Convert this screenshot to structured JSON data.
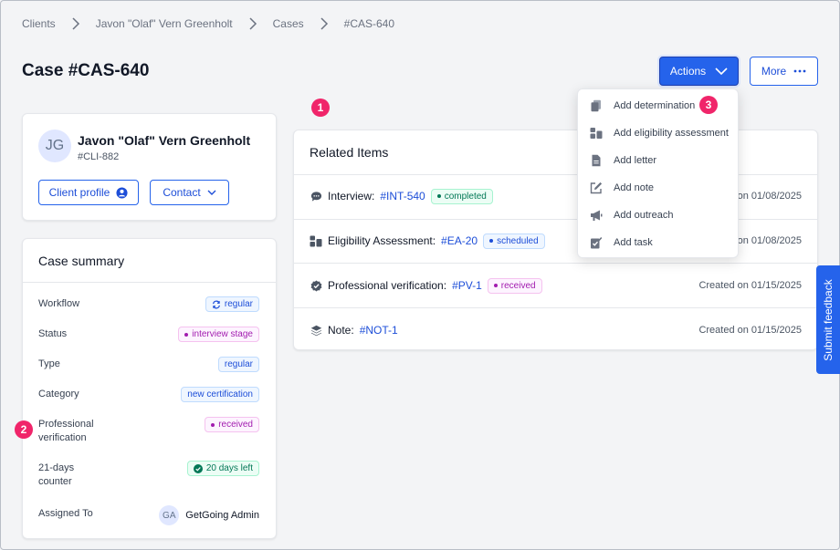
{
  "breadcrumb": {
    "items": [
      "Clients",
      "Javon \"Olaf\" Vern Greenholt",
      "Cases",
      "#CAS-640"
    ]
  },
  "page": {
    "title": "Case #CAS-640"
  },
  "header_actions": {
    "actions_label": "Actions",
    "more_label": "More"
  },
  "client": {
    "initials": "JG",
    "name": "Javon \"Olaf\" Vern Greenholt",
    "id": "#CLI-882",
    "profile_button": "Client profile",
    "contact_button": "Contact"
  },
  "summary": {
    "title": "Case summary",
    "rows": [
      {
        "label": "Workflow",
        "value": "regular"
      },
      {
        "label": "Status",
        "value": "interview stage"
      },
      {
        "label": "Type",
        "value": "regular"
      },
      {
        "label": "Category",
        "value": "new certification"
      },
      {
        "label": "Professional verification",
        "value": "received"
      },
      {
        "label": "21-days counter",
        "value": "20 days left"
      },
      {
        "label": "Assigned To",
        "value": "GetGoing Admin",
        "initials": "GA"
      }
    ]
  },
  "related": {
    "title": "Related Items",
    "items": [
      {
        "type": "Interview:",
        "link": "#INT-540",
        "badge": "completed",
        "date": "on 01/08/2025"
      },
      {
        "type": "Eligibility Assessment:",
        "link": "#EA-20",
        "badge": "scheduled",
        "date": "on 01/08/2025"
      },
      {
        "type": "Professional verification:",
        "link": "#PV-1",
        "badge": "received",
        "date": "Created on 01/15/2025"
      },
      {
        "type": "Note:",
        "link": "#NOT-1",
        "badge": "",
        "date": "Created on 01/15/2025"
      }
    ]
  },
  "dropdown": {
    "items": [
      "Add determination",
      "Add eligibility assessment",
      "Add letter",
      "Add note",
      "Add outreach",
      "Add task"
    ]
  },
  "feedback": {
    "label": "Submit feedback"
  },
  "markers": [
    "1",
    "2",
    "3"
  ],
  "colors": {
    "primary": "#2563eb",
    "marker": "#f0256a",
    "status_purple": "#a21caf",
    "status_green": "#047857"
  }
}
